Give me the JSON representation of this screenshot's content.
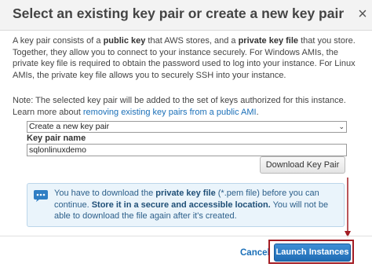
{
  "dialog": {
    "title": "Select an existing key pair or create a new key pair",
    "close_symbol": "×",
    "description": {
      "p1": "A key pair consists of a ",
      "b1": "public key",
      "p2": " that AWS stores, and a ",
      "b2": "private key file",
      "p3": " that you store. Together, they allow you to connect to your instance securely. For Windows AMIs, the private key file is required to obtain the password used to log into your instance. For Linux AMIs, the private key file allows you to securely SSH into your instance."
    },
    "note": {
      "text": "Note: The selected key pair will be added to the set of keys authorized for this instance. Learn more about ",
      "link": "removing existing key pairs from a public AMI",
      "end": "."
    },
    "select": {
      "value": "Create a new key pair",
      "chevron": "⌄"
    },
    "key_pair_name": {
      "label": "Key pair name",
      "value": "sqlonlinuxdemo"
    },
    "download_button": "Download Key Pair",
    "info": {
      "t1": "You have to download the ",
      "b1": "private key file",
      "t2": " (*.pem file) before you can continue. ",
      "b2": "Store it in a secure and accessible location.",
      "t3": " You will not be able to download the file again after it's created."
    },
    "footer": {
      "cancel": "Cancel",
      "launch": "Launch Instances"
    },
    "colors": {
      "accent": "#1a6fb8",
      "highlight": "#a31d24",
      "info_bg": "#eaf4fb"
    },
    "icons": {
      "info": "chat-bubble-info-icon",
      "close": "close-icon",
      "arrow": "annotation-arrow"
    }
  }
}
